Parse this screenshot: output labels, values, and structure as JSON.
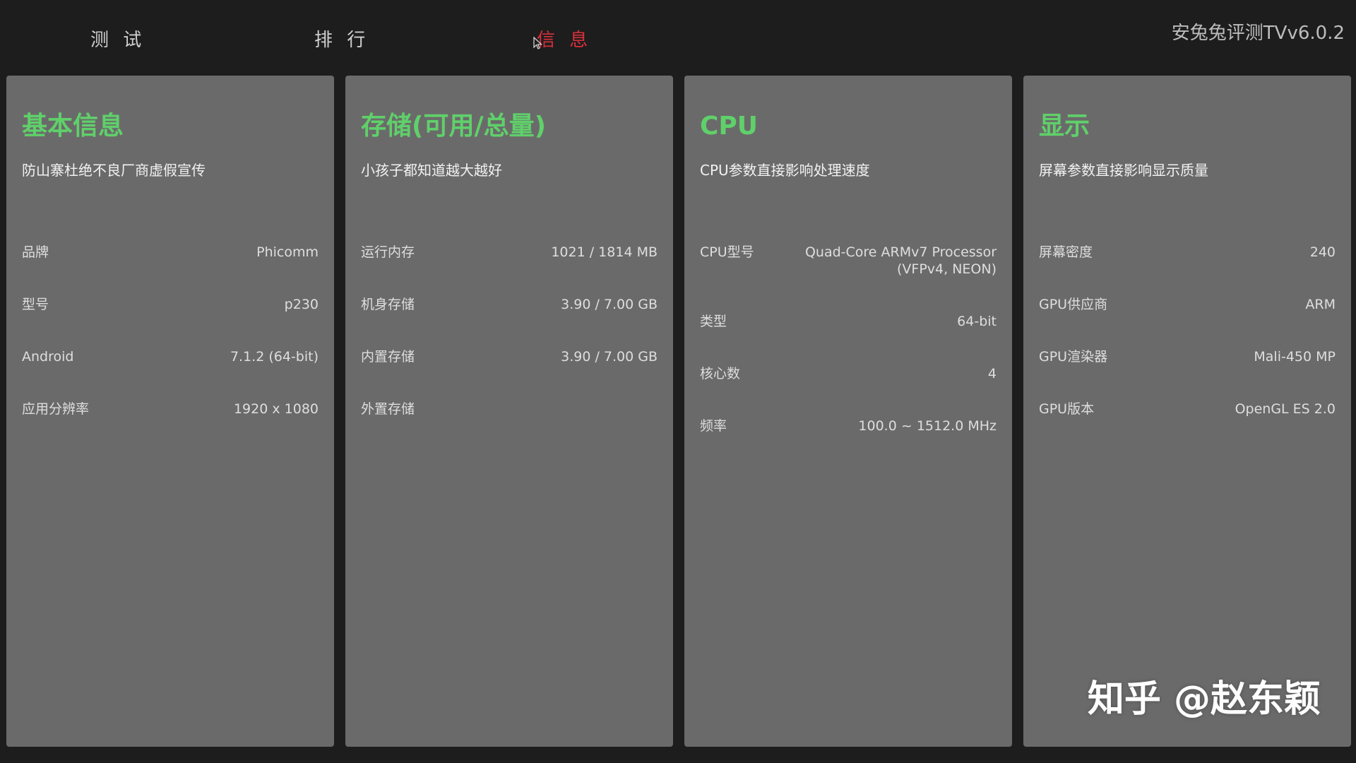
{
  "tabs": [
    {
      "label": "测 试"
    },
    {
      "label": "排 行"
    },
    {
      "label": "信 息"
    }
  ],
  "active_tab": "信 息",
  "app_title": "安兔兔评测TVv6.0.2",
  "colors": {
    "background": "#1d1d1d",
    "card": "#6b6a6b",
    "heading_green": "#5fd06a",
    "active_tab_red": "#d8303c"
  },
  "cards": [
    {
      "title": "基本信息",
      "subtitle": "防山寨杜绝不良厂商虚假宣传",
      "rows": [
        {
          "label": "品牌",
          "value": "Phicomm"
        },
        {
          "label": "型号",
          "value": "p230"
        },
        {
          "label": "Android",
          "value": "7.1.2 (64-bit)"
        },
        {
          "label": "应用分辨率",
          "value": "1920 x 1080"
        }
      ]
    },
    {
      "title": "存储(可用/总量)",
      "subtitle": "小孩子都知道越大越好",
      "rows": [
        {
          "label": "运行内存",
          "value": "1021 / 1814 MB"
        },
        {
          "label": "机身存储",
          "value": "3.90 / 7.00 GB"
        },
        {
          "label": "内置存储",
          "value": "3.90 / 7.00 GB"
        },
        {
          "label": "外置存储",
          "value": ""
        }
      ]
    },
    {
      "title": "CPU",
      "subtitle": "CPU参数直接影响处理速度",
      "rows": [
        {
          "label": "CPU型号",
          "value": "Quad-Core ARMv7 Processor\n(VFPv4, NEON)"
        },
        {
          "label": "类型",
          "value": "64-bit"
        },
        {
          "label": "核心数",
          "value": "4"
        },
        {
          "label": "频率",
          "value": "100.0 ~ 1512.0 MHz"
        }
      ]
    },
    {
      "title": "显示",
      "subtitle": "屏幕参数直接影响显示质量",
      "rows": [
        {
          "label": "屏幕密度",
          "value": "240"
        },
        {
          "label": "GPU供应商",
          "value": "ARM"
        },
        {
          "label": "GPU渲染器",
          "value": "Mali-450 MP"
        },
        {
          "label": "GPU版本",
          "value": "OpenGL ES 2.0"
        }
      ]
    }
  ],
  "watermark": "知乎 @赵东颖",
  "icons": {
    "cursor": "mouse-pointer-icon"
  }
}
